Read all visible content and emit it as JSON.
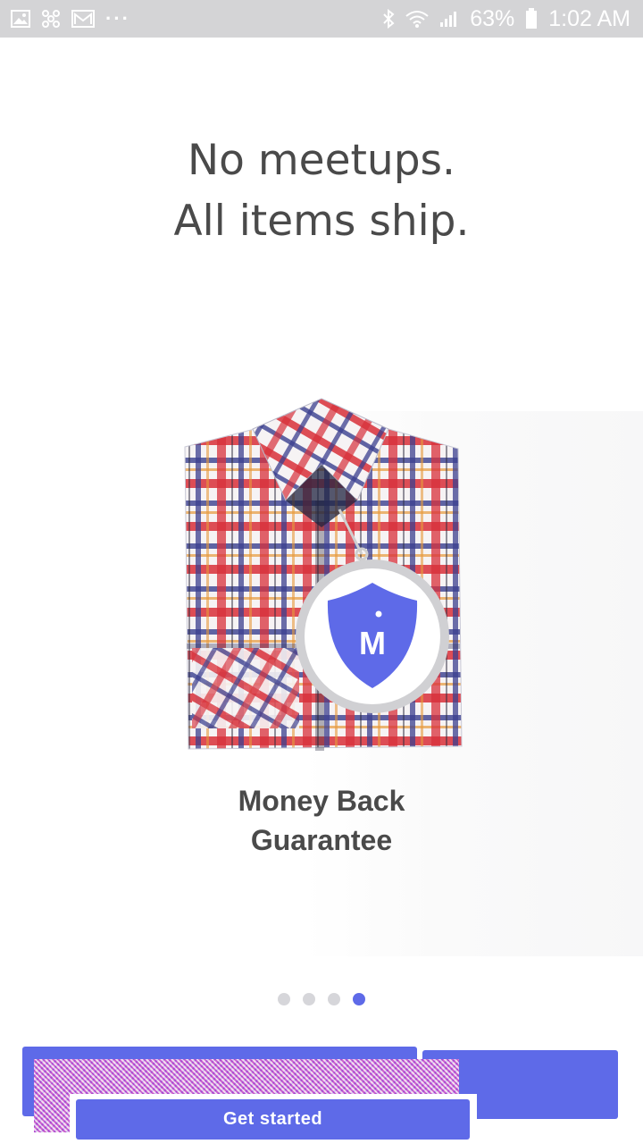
{
  "status_bar": {
    "battery_percent": "63%",
    "time": "1:02 AM",
    "left_icons": [
      "gallery-icon",
      "pinwheel-icon",
      "gmail-icon",
      "more-dots-icon"
    ],
    "right_icons": [
      "bluetooth-icon",
      "wifi-icon",
      "signal-icon",
      "battery-icon"
    ]
  },
  "onboarding": {
    "headline_line1": "No meetups.",
    "headline_line2": "All items ship.",
    "caption_line1": "Money Back",
    "caption_line2": "Guarantee",
    "badge_letter": "M",
    "pager": {
      "total": 4,
      "active_index": 3
    },
    "cta_label": "Get started"
  },
  "colors": {
    "accent": "#5e6ae8",
    "text": "#4a4a4a",
    "status_bar_bg": "#d4d4d6",
    "dot_inactive": "#d6d6da"
  }
}
